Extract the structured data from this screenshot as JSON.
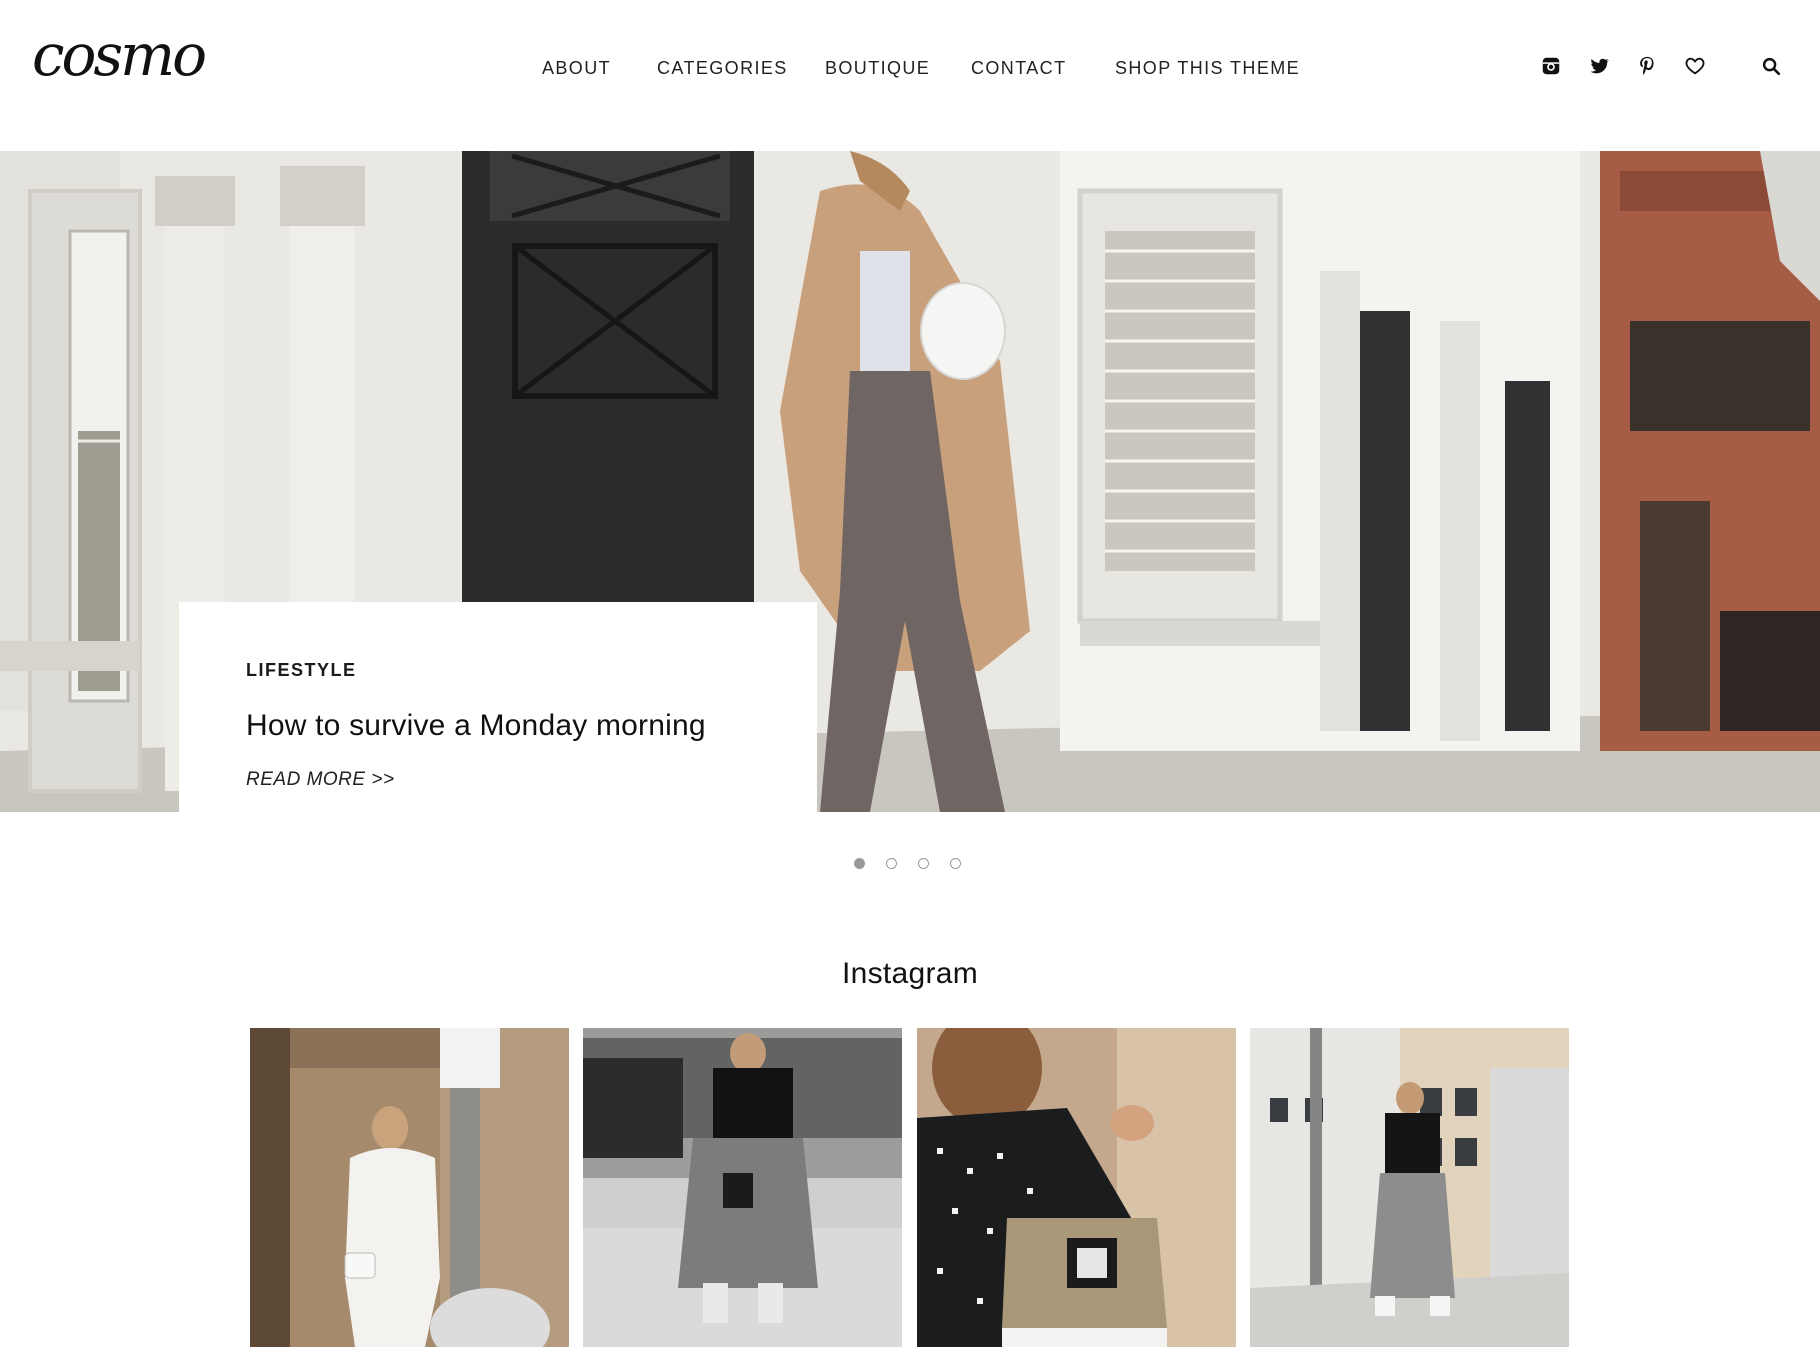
{
  "header": {
    "logo": "cosmo",
    "nav": [
      {
        "label": "ABOUT"
      },
      {
        "label": "CATEGORIES"
      },
      {
        "label": "BOUTIQUE"
      },
      {
        "label": "CONTACT"
      },
      {
        "label": "SHOP THIS THEME"
      }
    ],
    "icons": [
      "instagram-icon",
      "twitter-icon",
      "pinterest-icon",
      "heart-icon",
      "search-icon"
    ]
  },
  "hero": {
    "category": "LIFESTYLE",
    "title": "How to survive a Monday morning",
    "read_more": "READ MORE >>",
    "slides": 4,
    "active_slide": 1
  },
  "instagram": {
    "title": "Instagram",
    "tiles": 4
  },
  "colors": {
    "text": "#1a1a1a",
    "dot": "#9a9a9a",
    "background": "#ffffff"
  }
}
